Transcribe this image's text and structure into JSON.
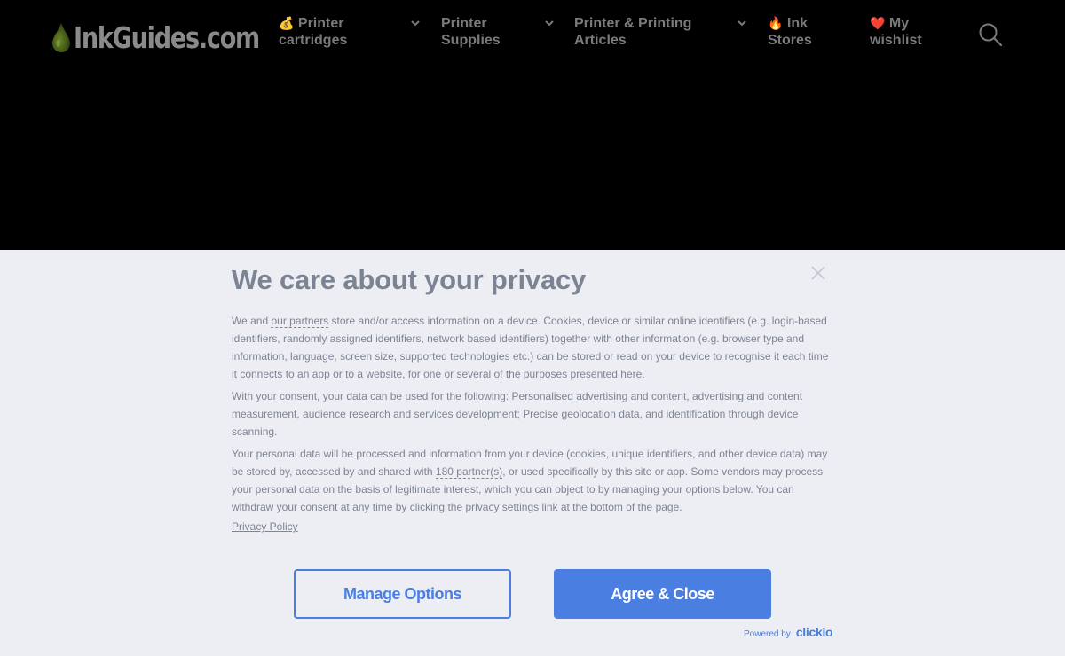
{
  "header": {
    "logo_text": "InkGuides.com",
    "nav": [
      {
        "emoji": "💰",
        "line1": "Printer",
        "line2": "cartridges",
        "has_dropdown": true
      },
      {
        "emoji": "",
        "line1": "Printer",
        "line2": "Supplies",
        "has_dropdown": true
      },
      {
        "emoji": "",
        "line1": "Printer & Printing",
        "line2": "Articles",
        "has_dropdown": true
      },
      {
        "emoji": "🔥",
        "line1": "Ink",
        "line2": "Stores",
        "has_dropdown": false
      },
      {
        "emoji": "❤️",
        "line1": "My",
        "line2": "wishlist",
        "has_dropdown": false
      }
    ],
    "search_icon": "search-icon"
  },
  "consent": {
    "title": "We care about your privacy",
    "close_icon": "close-icon",
    "p1_before": "We and ",
    "p1_link": "our partners",
    "p1_after": " store and/or access information on a device. Cookies, device or similar online identifiers (e.g. login-based identifiers, randomly assigned identifiers, network based identifiers) together with other information (e.g. browser type and information, language, screen size, supported technologies etc.) can be stored or read on your device to recognise it each time it connects to an app or to a website, for one or several of the purposes presented here.",
    "p2": "With your consent, your data can be used for the following: Personalised advertising and content, advertising and content measurement, audience research and services development; Precise geolocation data, and identification through device scanning.",
    "p3_before": "Your personal data will be processed and information from your device (cookies, unique identifiers, and other device data) may be stored by, accessed by and shared with ",
    "p3_link": "180 partner(s)",
    "p3_after": ", or used specifically by this site or app. Some vendors may process your personal data on the basis of legitimate interest, which you can object to by managing your options below. You can withdraw your consent at any time by clicking the privacy settings link at the bottom of the page.",
    "privacy_policy": "Privacy Policy",
    "manage_label": "Manage Options",
    "agree_label": "Agree & Close",
    "powered_by": "Powered by",
    "powered_brand": "clickio"
  },
  "colors": {
    "header_bg": "#000000",
    "consent_bg": "#eceef3",
    "accent": "#4a7ee0",
    "text": "#7d8494"
  }
}
